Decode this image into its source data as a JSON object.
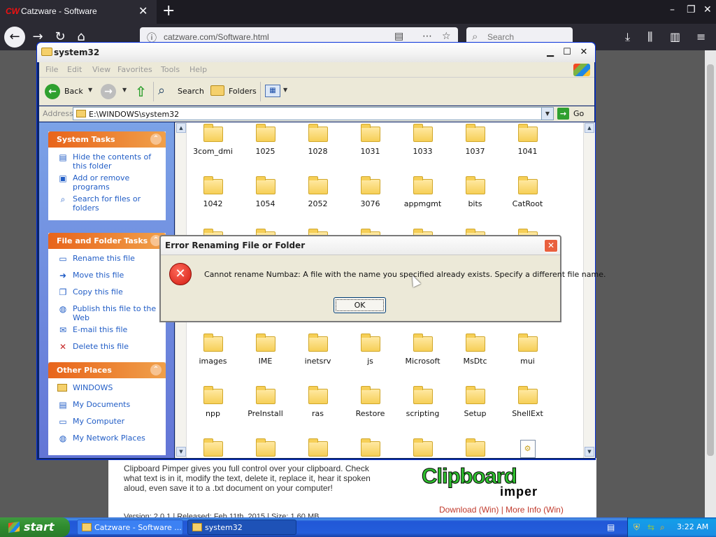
{
  "browser": {
    "tab_title": "Catzware - Software",
    "tab_favicon": "CW",
    "url": "catzware.com/Software.html",
    "search_placeholder": "Search"
  },
  "page": {
    "promo_text": "Clipboard Pimper gives you full control over your clipboard. Check what text is in it, modify the text, delete it, replace it, hear it spoken aloud, even save it to a .txt document on your computer!",
    "logo_main": "Clipboard",
    "logo_sub": "imper",
    "links": "Download (Win) | More Info (Win)",
    "version_line": "Version: 2.0.1 | Released: Feb 11th, 2015 | Size: 1.60 MB"
  },
  "explorer": {
    "title": "system32",
    "menu": [
      "File",
      "Edit",
      "View",
      "Favorites",
      "Tools",
      "Help"
    ],
    "toolbar": {
      "back": "Back",
      "search": "Search",
      "folders": "Folders"
    },
    "address": {
      "label": "Address",
      "path": "E:\\WINDOWS\\system32",
      "go": "Go"
    },
    "system_tasks": {
      "header": "System Tasks",
      "items": [
        "Hide the contents of this folder",
        "Add or remove programs",
        "Search for files or folders"
      ]
    },
    "file_tasks": {
      "header": "File and Folder Tasks",
      "items": [
        "Rename this file",
        "Move this file",
        "Copy this file",
        "Publish this file to the Web",
        "E-mail this file",
        "Delete this file"
      ]
    },
    "other_places": {
      "header": "Other Places",
      "items": [
        "WINDOWS",
        "My Documents",
        "My Computer",
        "My Network Places"
      ]
    },
    "folders_row1": [
      "3com_dmi",
      "1025",
      "1028",
      "1031",
      "1033",
      "1037",
      "1041"
    ],
    "folders_row2": [
      "1042",
      "1054",
      "2052",
      "3076",
      "appmgmt",
      "bits",
      "CatRoot"
    ],
    "folders_row3": [
      "images",
      "IME",
      "inetsrv",
      "js",
      "Microsoft",
      "MsDtc",
      "mui"
    ],
    "folders_row4": [
      "npp",
      "PreInstall",
      "ras",
      "Restore",
      "scripting",
      "Setup",
      "ShellExt"
    ]
  },
  "dialog": {
    "title": "Error Renaming File or Folder",
    "message": "Cannot rename Numbaz: A file with the name you specified already exists. Specify a different file name.",
    "ok": "OK"
  },
  "taskbar": {
    "start": "start",
    "buttons": [
      "Catzware - Software ...",
      "system32"
    ],
    "clock": "3:22 AM"
  }
}
